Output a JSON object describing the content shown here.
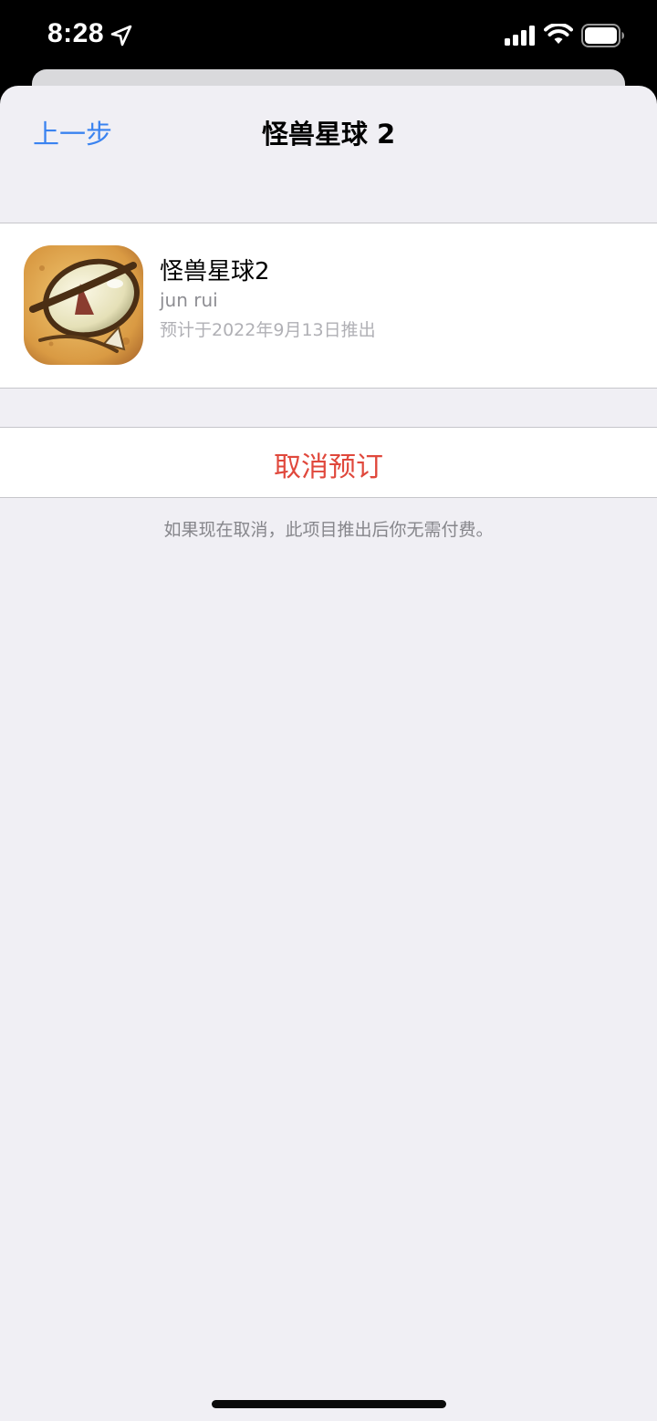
{
  "status_bar": {
    "time": "8:28",
    "icons": [
      "location-arrow-icon",
      "cellular-signal-icon",
      "wifi-icon",
      "battery-icon"
    ]
  },
  "nav": {
    "back_label": "上一步",
    "title": "怪兽星球 2"
  },
  "app": {
    "name": "怪兽星球2",
    "developer": "jun rui",
    "release_note": "预计于2022年9月13日推出",
    "icon": "monster-app-icon"
  },
  "actions": {
    "cancel_label": "取消预订"
  },
  "footnote": "如果现在取消，此项目推出后你无需付费。",
  "colors": {
    "accent": "#3a83f0",
    "destructive": "#e0483c",
    "background": "#f0eff4"
  }
}
